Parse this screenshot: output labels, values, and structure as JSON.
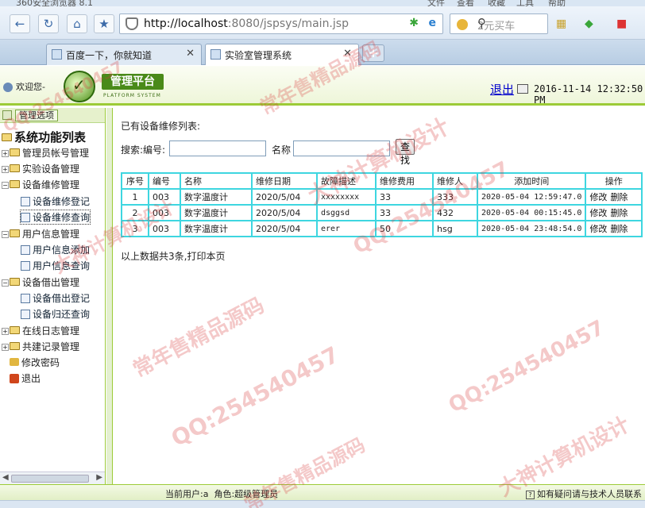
{
  "browser": {
    "title_fragment": "360安全浏览器 8.1",
    "top_menu": [
      "文件",
      "查看",
      "收藏",
      "工具",
      "帮助"
    ],
    "url_host": "http://localhost",
    "url_rest": ":8080/jspsys/main.jsp",
    "search_placeholder": "2元买车",
    "tabs": [
      {
        "label": "百度一下，你就知道",
        "active": false
      },
      {
        "label": "实验室管理系统",
        "active": true
      }
    ],
    "new_tab": "+"
  },
  "header": {
    "welcome": "欢迎您-",
    "logo_title": "管理平台",
    "logo_sub": "PLATFORM SYSTEM",
    "logout": "退出",
    "datetime": "2016-11-14 12:32:50 PM"
  },
  "sidebar": {
    "tag": "管理选项",
    "title": "系统功能列表",
    "items": [
      {
        "label": "管理员帐号管理",
        "type": "folder",
        "expanded": false
      },
      {
        "label": "实验设备管理",
        "type": "folder",
        "expanded": false
      },
      {
        "label": "设备维修管理",
        "type": "folder",
        "expanded": true
      },
      {
        "label": "设备维修登记",
        "type": "page"
      },
      {
        "label": "设备维修查询",
        "type": "page",
        "selected": true
      },
      {
        "label": "用户信息管理",
        "type": "folder",
        "expanded": true
      },
      {
        "label": "用户信息添加",
        "type": "page"
      },
      {
        "label": "用户信息查询",
        "type": "page"
      },
      {
        "label": "设备借出管理",
        "type": "folder",
        "expanded": true
      },
      {
        "label": "设备借出登记",
        "type": "page"
      },
      {
        "label": "设备归还查询",
        "type": "page"
      },
      {
        "label": "在线日志管理",
        "type": "folder",
        "expanded": false
      },
      {
        "label": "共建记录管理",
        "type": "folder",
        "expanded": false
      },
      {
        "label": "修改密码",
        "type": "key"
      },
      {
        "label": "退出",
        "type": "exit"
      }
    ]
  },
  "main": {
    "caption": "已有设备维修列表:",
    "search": {
      "label_search": "搜索:编号:",
      "label_name": "名称",
      "button": "查找",
      "code_value": "",
      "name_value": ""
    },
    "table": {
      "headers": [
        "序号",
        "编号",
        "名称",
        "维修日期",
        "故障描述",
        "维修费用",
        "维修人",
        "添加时间",
        "操作"
      ],
      "rows": [
        [
          "1",
          "003",
          "数字温度计",
          "2020/5/04",
          "xxxxxxxx",
          "33",
          "333",
          "2020-05-04 12:59:47.0"
        ],
        [
          "2",
          "003",
          "数字温度计",
          "2020/5/04",
          "dsggsd",
          "33",
          "432",
          "2020-05-04 00:15:45.0"
        ],
        [
          "3",
          "003",
          "数字温度计",
          "2020/5/04",
          "erer",
          "50",
          "hsg",
          "2020-05-04 23:48:54.0"
        ]
      ],
      "op_edit": "修改",
      "op_delete": "删除"
    },
    "footer_prefix": "以上数据共3条,",
    "footer_print": "打印本页"
  },
  "statusbar": {
    "current_user": "当前用户:a",
    "role": "角色:超级管理员",
    "help": "如有疑问请与技术人员联系"
  },
  "watermarks": [
    "QQ:254540457",
    "常年售精品源码",
    "大神计算机设计"
  ]
}
